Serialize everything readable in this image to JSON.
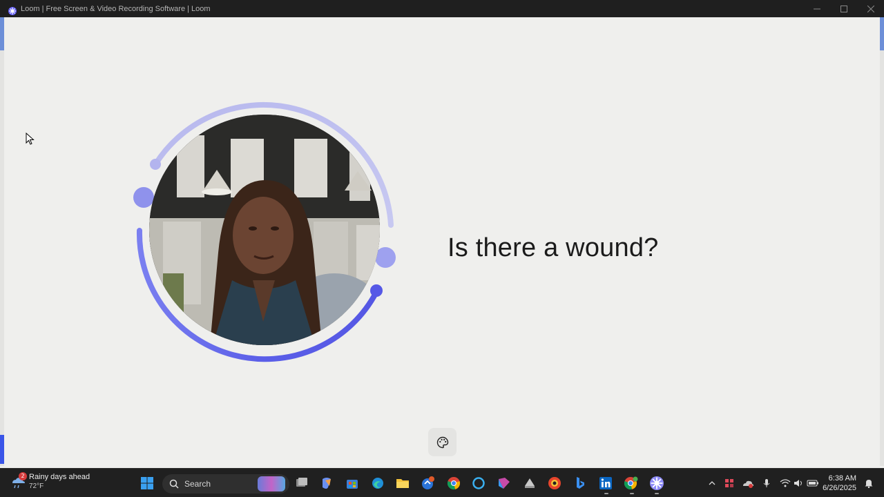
{
  "window": {
    "title": "Loom | Free Screen & Video Recording Software | Loom",
    "accent": "#6b6ff0"
  },
  "main": {
    "caption": "Is there a wound?"
  },
  "taskbar": {
    "weather": {
      "title": "Rainy days ahead",
      "temp": "72°F",
      "badge": "2"
    },
    "search": {
      "label": "Search"
    },
    "clock": {
      "time": "6:38 AM",
      "date": "6/26/2025"
    },
    "icons": [
      "windows-start",
      "search",
      "task-view",
      "copilot",
      "microsoft-store",
      "edge",
      "file-explorer",
      "app",
      "chrome",
      "cortana",
      "copilot-app",
      "app",
      "opera",
      "bing",
      "linkedin",
      "chrome-profile",
      "loom"
    ]
  }
}
